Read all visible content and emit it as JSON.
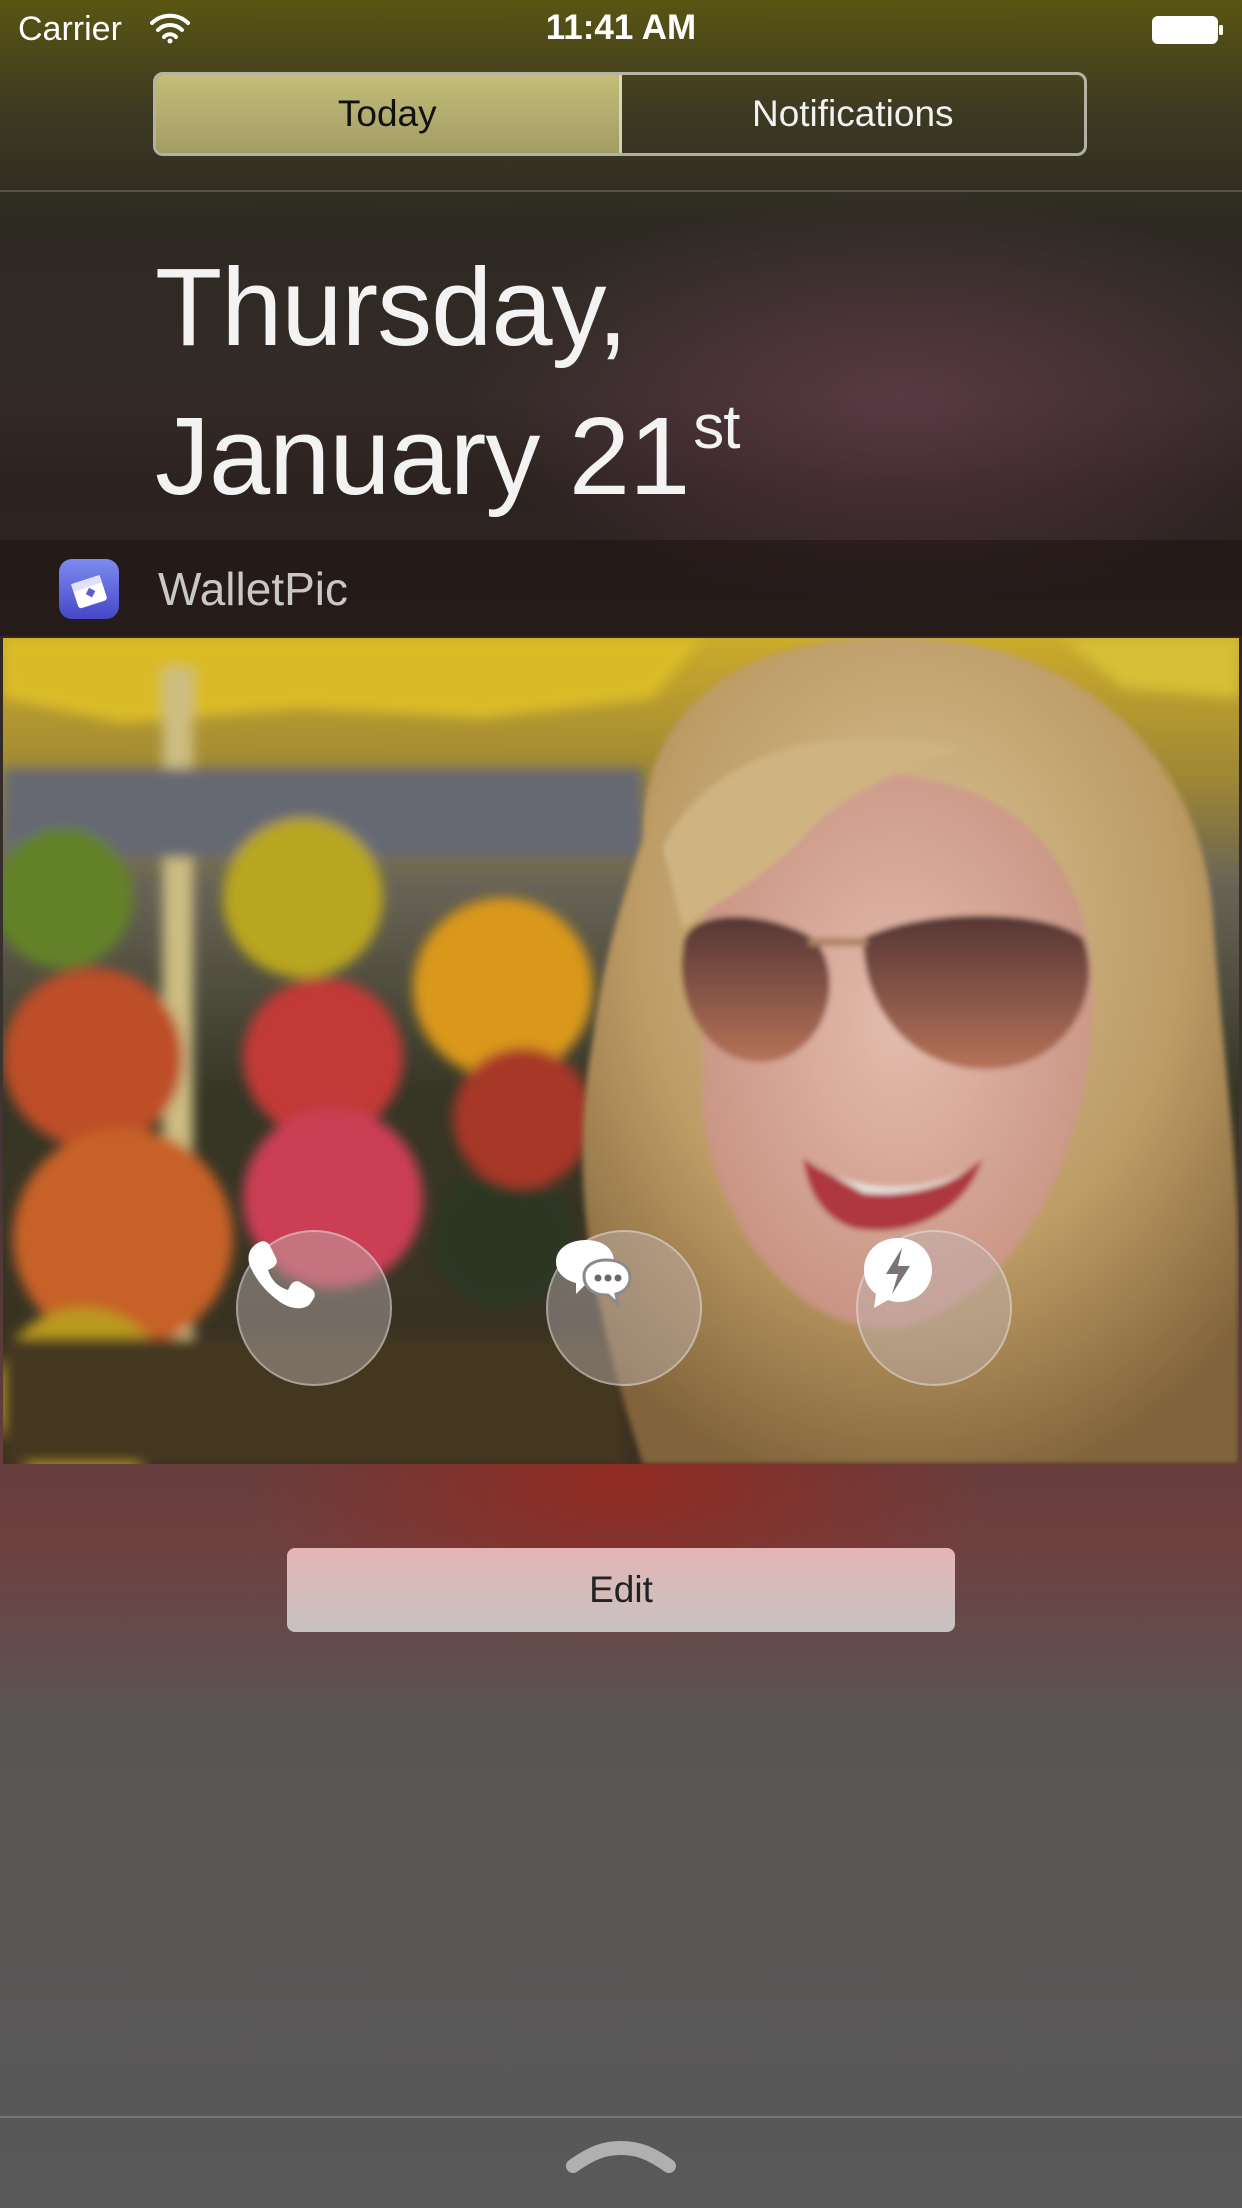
{
  "status_bar": {
    "carrier": "Carrier",
    "time": "11:41 AM",
    "wifi_icon": "wifi-icon",
    "battery_icon": "battery-icon"
  },
  "tabs": [
    {
      "label": "Today",
      "selected": true
    },
    {
      "label": "Notifications",
      "selected": false
    }
  ],
  "date": {
    "line1": "Thursday,",
    "line2": "January 21",
    "suffix": "st"
  },
  "widget": {
    "app_name": "WalletPic",
    "app_icon": "wallet-photo-icon",
    "actions": [
      {
        "name": "call",
        "icon": "phone-icon"
      },
      {
        "name": "message",
        "icon": "chat-bubbles-icon"
      },
      {
        "name": "messenger",
        "icon": "messenger-icon"
      }
    ]
  },
  "edit_label": "Edit",
  "colors": {
    "segment_active": "#b8b272",
    "app_icon": "#5a5ad8",
    "edit_button": "#d9bcbc"
  }
}
